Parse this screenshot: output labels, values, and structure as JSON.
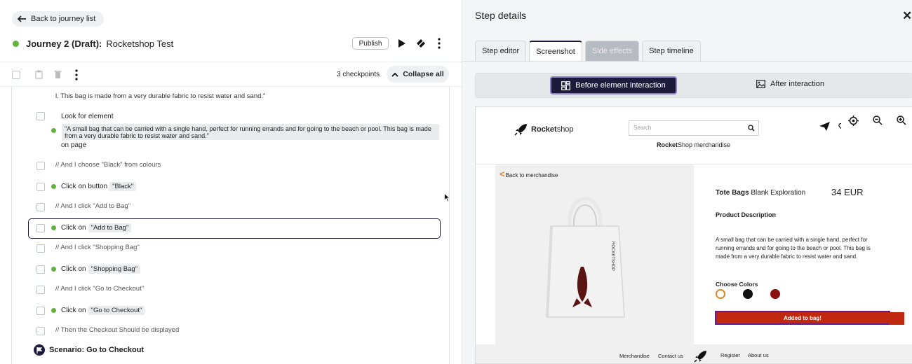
{
  "left": {
    "back_label": "Back to journey list",
    "journey_label": "Journey 2 (Draft):",
    "journey_name": "Rocketshop Test",
    "publish_label": "Publish",
    "checkpoints_label": "3 checkpoints",
    "collapse_label": "Collapse all",
    "partial_text": "l. This bag is made from a very durable fabric to resist water and sand.\"",
    "look_label": "Look for element",
    "look_quote": "\"A small bag that can be carried with a single hand, perfect for running errands and for going to the beach or pool. This bag is made from a very durable fabric to resist water and sand.\"",
    "look_suffix": "on page",
    "steps": [
      {
        "type": "comment",
        "text": "// And I choose \"Black\" from colours"
      },
      {
        "type": "action",
        "text": "Click on button",
        "chip": "\"Black\""
      },
      {
        "type": "comment",
        "text": "// And I click \"Add to Bag\""
      },
      {
        "type": "action",
        "text": "Click on",
        "chip": "\"Add to Bag\"",
        "selected": true
      },
      {
        "type": "comment",
        "text": "// And I click \"Shopping Bag\""
      },
      {
        "type": "action",
        "text": "Click on",
        "chip": "\"Shopping Bag\""
      },
      {
        "type": "comment",
        "text": "// And I click \"Go to Checkout\""
      },
      {
        "type": "action",
        "text": "Click on",
        "chip": "\"Go to Checkout\""
      },
      {
        "type": "comment",
        "text": "// Then the Checkout Should be displayed"
      }
    ],
    "scenario_label": "Scenario: Go to Checkout"
  },
  "right": {
    "title": "Step details",
    "tabs": [
      {
        "label": "Step editor",
        "state": "normal"
      },
      {
        "label": "Screenshot",
        "state": "active"
      },
      {
        "label": "Side effects",
        "state": "disabled"
      },
      {
        "label": "Step timeline",
        "state": "normal"
      }
    ],
    "before_label": "Before element interaction",
    "after_label": "After interaction",
    "shop": {
      "logo_bold": "Rocket",
      "logo_rest": "shop",
      "search_placeholder": "Search",
      "sub_bold": "Rocket",
      "sub_rest": "Shop merchandise",
      "back_label": "Back to merchandise",
      "bag_text": "ROCKETSHOP",
      "product_bold": "Tote Bags",
      "product_rest": " Blank Exploration",
      "price": "34 EUR",
      "desc_heading": "Product Description",
      "desc": "A small bag that can be carried with a single hand, perfect for running errands and for going to the beach or pool. This bag is made from a very durable fabric to resist water and sand.",
      "colors_heading": "Choose Colors",
      "swatch_colors": [
        "#ffffff",
        "#111111",
        "#8b1010"
      ],
      "swatch_ring": "#d98a2a",
      "added_label": "Added to bag!",
      "footer": [
        "Merchandise",
        "Contact us",
        "Register",
        "About us"
      ]
    }
  },
  "colors": {
    "accent_dark": "#1d1a3a",
    "status_green": "#62b33e",
    "brand_red": "#c0290f"
  }
}
